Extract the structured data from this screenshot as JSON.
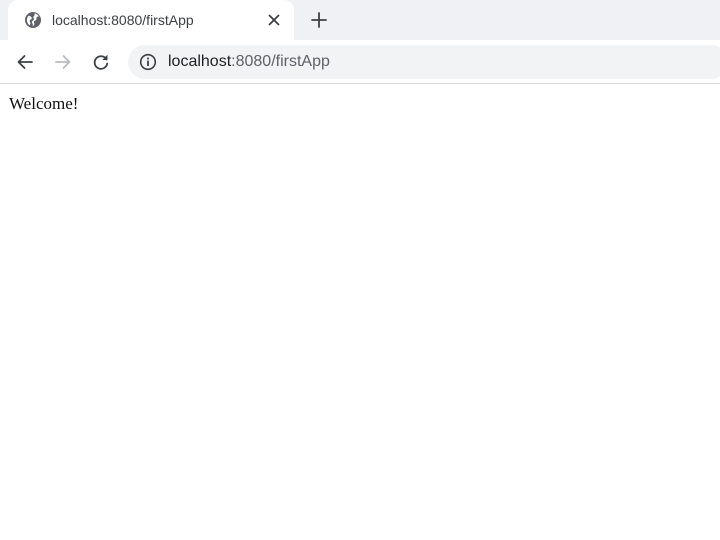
{
  "tab": {
    "title": "localhost:8080/firstApp",
    "favicon": "globe-icon"
  },
  "toolbar": {
    "url_host": "localhost",
    "url_rest": ":8080/firstApp"
  },
  "page": {
    "text": "Welcome!"
  },
  "colors": {
    "tab_strip": "#eff1f4",
    "omnibox": "#f1f3f4",
    "icon": "#5f6368",
    "icon_disabled": "#b9bcc0"
  }
}
